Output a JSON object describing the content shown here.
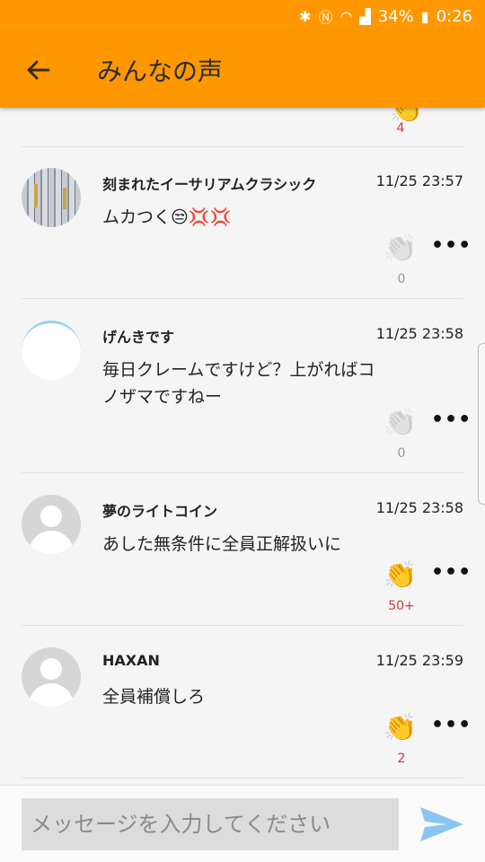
{
  "status": {
    "battery": "34%",
    "time": "0:26"
  },
  "header": {
    "title": "みんなの声"
  },
  "partial": {
    "count": "4"
  },
  "comments": [
    {
      "user": "刻まれたイーサリアムクラシック",
      "time": "11/25 23:57",
      "text": "ムカつく😒💢💢",
      "claps": "0"
    },
    {
      "user": "げんきです",
      "time": "11/25 23:58",
      "text": "毎日クレームですけど？上がればコノザマですねー",
      "claps": "0"
    },
    {
      "user": "夢のライトコイン",
      "time": "11/25 23:58",
      "text": "あした無条件に全員正解扱いに",
      "claps": "50+"
    },
    {
      "user": "HAXAN",
      "time": "11/25 23:59",
      "text": "全員補償しろ",
      "claps": "2"
    }
  ],
  "composer": {
    "placeholder": "メッセージを入力してください"
  },
  "icons": {
    "back": "arrow-left-icon",
    "clap": "clapping-hands-icon",
    "more": "more-horizontal-icon",
    "send": "send-icon"
  },
  "colors": {
    "appbar": "#ff9800",
    "count": "#d33333",
    "send": "#8cc4f5"
  }
}
